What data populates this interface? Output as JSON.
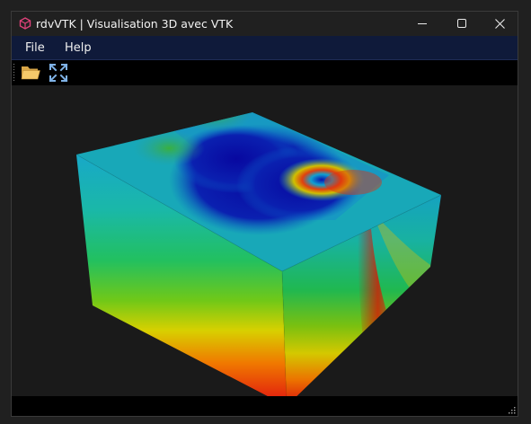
{
  "window": {
    "title": "rdvVTK | Visualisation 3D avec VTK"
  },
  "menubar": {
    "items": [
      "File",
      "Help"
    ]
  },
  "toolbar": {
    "tools": [
      "open-folder-icon",
      "fullscreen-icon"
    ]
  },
  "colors": {
    "menubar_bg": "#0f1a3a",
    "viewport_bg": "#1a1a1a",
    "colormap": [
      "#0a0aa0",
      "#0a68c8",
      "#18aac0",
      "#20c080",
      "#40c020",
      "#c8d000",
      "#f08000",
      "#e01010"
    ]
  },
  "viewport": {
    "object": "vtk-3d-block"
  }
}
